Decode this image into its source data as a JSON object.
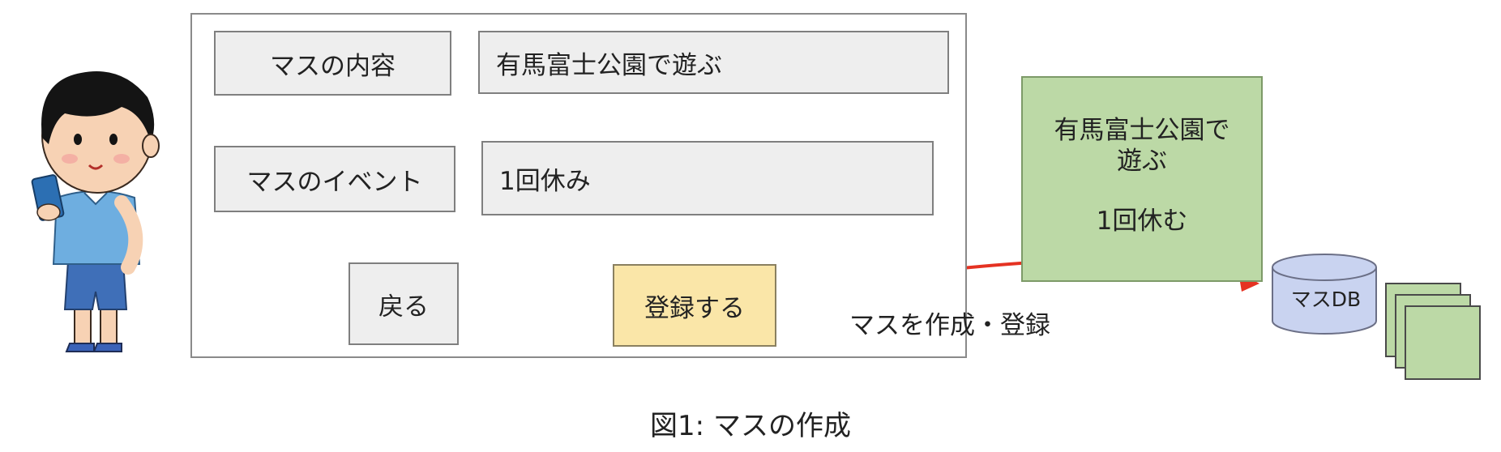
{
  "form": {
    "cell_content_label": "マスの内容",
    "cell_content_value": "有馬富士公園で遊ぶ",
    "cell_event_label": "マスのイベント",
    "cell_event_value": "1回休み",
    "back_button": "戻る",
    "register_button": "登録する"
  },
  "result_card": {
    "line1": "有馬富士公園で",
    "line2": "遊ぶ",
    "line3": "1回休む"
  },
  "arrow_label": "マスを作成・登録",
  "database": {
    "label": "マスDB"
  },
  "caption": "図1: マスの作成",
  "colors": {
    "panel_border": "#8a8a8a",
    "field_bg": "#eeeeee",
    "register_bg": "#fae6a8",
    "card_bg": "#bcd9a6",
    "db_fill": "#c9d3f0",
    "arrow": "#e53222",
    "stack_fill": "#bcd9a6"
  }
}
